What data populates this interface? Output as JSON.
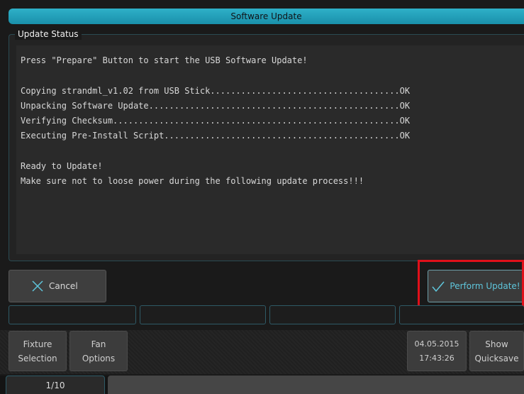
{
  "title": "Software Update",
  "group_label": "Update Status",
  "console_lines": [
    "Press \"Prepare\" Button to start the USB Software Update!",
    "",
    "Copying strandml_v1.02 from USB Stick.....................................OK",
    "Unpacking Software Update.................................................OK",
    "Verifying Checksum........................................................OK",
    "Executing Pre-Install Script..............................................OK",
    "",
    "Ready to Update!",
    "Make sure not to loose power during the following update process!!!"
  ],
  "buttons": {
    "cancel": "Cancel",
    "perform": "Perform Update!"
  },
  "softkeys": {
    "fixture_line1": "Fixture",
    "fixture_line2": "Selection",
    "fan_line1": "Fan",
    "fan_line2": "Options",
    "show_line1": "Show",
    "show_line2": "Quicksave"
  },
  "datetime": {
    "date": "04.05.2015",
    "time": "17:43:26"
  },
  "page": "1/10",
  "icons": {
    "cancel": "close-icon",
    "perform": "checkmark-icon"
  },
  "colors": {
    "accent": "#1fa3bd",
    "highlight": "#e0101a"
  }
}
